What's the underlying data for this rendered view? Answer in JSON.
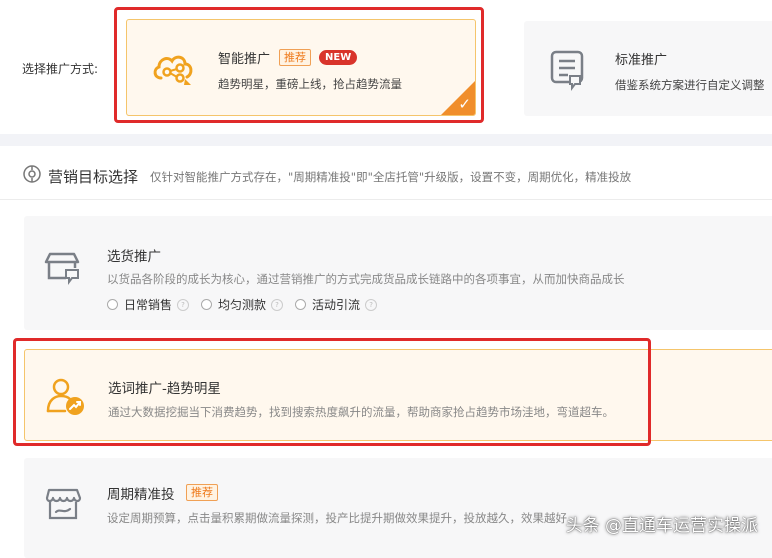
{
  "method": {
    "label": "选择推广方式:",
    "smart": {
      "title": "智能推广",
      "tag": "推荐",
      "badge": "NEW",
      "desc": "趋势明星，重磅上线，抢占趋势流量",
      "icon": "cloud-share-icon"
    },
    "standard": {
      "title": "标准推广",
      "desc": "借鉴系统方案进行自定义调整",
      "icon": "document-chat-icon"
    }
  },
  "section": {
    "title": "营销目标选择",
    "subtitle": "仅针对智能推广方式存在，\"周期精准投\"即\"全店托管\"升级版，设置不变，周期优化，精准投放",
    "icon": "target-icon"
  },
  "goals": [
    {
      "title": "选货推广",
      "desc": "以货品各阶段的成长为核心，通过营销推广的方式完成货品成长链路中的各项事宜，从而加快商品成长",
      "icon": "shop-card-icon",
      "options": [
        "日常销售",
        "均匀测款",
        "活动引流"
      ]
    },
    {
      "title": "选词推广-趋势明星",
      "desc": "通过大数据挖掘当下消费趋势，找到搜索热度飙升的流量，帮助商家抢占趋势市场洼地，弯道超车。",
      "icon": "user-trend-icon"
    },
    {
      "title": "周期精准投",
      "tag": "推荐",
      "desc": "设定周期预算，点击量积累期做流量探测，投产比提升期做效果提升，投放越久，效果越好",
      "icon": "store-icon"
    }
  ],
  "watermark": "头条 @直通车运营实操派",
  "colors": {
    "accent": "#f08e2b",
    "highlight_border": "#e02a2a",
    "selected_bg": "#fff8ee",
    "new_badge": "#d9342b"
  }
}
